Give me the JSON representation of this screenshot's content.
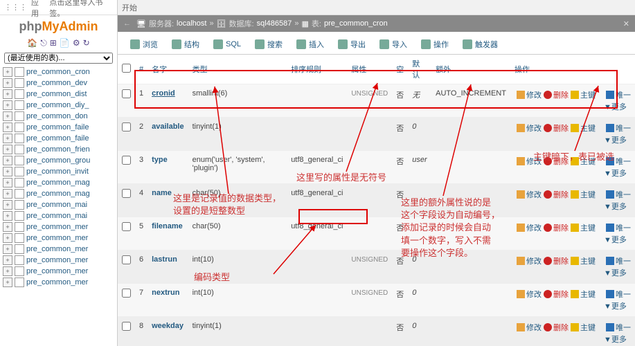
{
  "browser": {
    "apps": "应用",
    "hint": "点击这里导入书签。",
    "start": "开始"
  },
  "logo": {
    "p": "php",
    "m": "My",
    "a": "Admin"
  },
  "recent": {
    "placeholder": "(最近使用的表)..."
  },
  "tree_prefix": "pre_common_",
  "tree_items": [
    "cron",
    "dev",
    "dist",
    "diy_",
    "don",
    "faile",
    "faile",
    "frien",
    "grou",
    "invit",
    "mag",
    "mag",
    "mai",
    "mai",
    "mer",
    "mer",
    "mer",
    "mer",
    "mer",
    "mer"
  ],
  "bc": {
    "server_lbl": "服务器:",
    "server": "localhost",
    "db_lbl": "数据库:",
    "db": "sql486587",
    "tbl_lbl": "表:",
    "tbl": "pre_common_cron"
  },
  "tabs": [
    "浏览",
    "结构",
    "SQL",
    "搜索",
    "插入",
    "导出",
    "导入",
    "操作",
    "触发器"
  ],
  "th": {
    "num": "#",
    "name": "名字",
    "type": "类型",
    "coll": "排序规则",
    "attr": "属性",
    "null": "空",
    "def": "默认",
    "extra": "额外",
    "ops": "操作"
  },
  "op": {
    "edit": "修改",
    "del": "删除",
    "pk": "主键",
    "uq": "唯一",
    "more": "更多"
  },
  "null_no": "否",
  "rows": [
    {
      "n": 1,
      "name": "cronid",
      "u": true,
      "type": "smallint(6)",
      "coll": "",
      "attr": "UNSIGNED",
      "def": "无",
      "extra": "AUTO_INCREMENT"
    },
    {
      "n": 2,
      "name": "available",
      "u": false,
      "type": "tinyint(1)",
      "coll": "",
      "attr": "",
      "def": "0",
      "extra": ""
    },
    {
      "n": 3,
      "name": "type",
      "u": false,
      "type": "enum('user', 'system', 'plugin')",
      "coll": "utf8_general_ci",
      "attr": "",
      "def": "user",
      "extra": ""
    },
    {
      "n": 4,
      "name": "name",
      "u": false,
      "type": "char(50)",
      "coll": "utf8_general_ci",
      "attr": "",
      "def": "",
      "extra": ""
    },
    {
      "n": 5,
      "name": "filename",
      "u": false,
      "type": "char(50)",
      "coll": "utf8_general_ci",
      "attr": "",
      "def": "",
      "extra": ""
    },
    {
      "n": 6,
      "name": "lastrun",
      "u": false,
      "type": "int(10)",
      "coll": "",
      "attr": "UNSIGNED",
      "def": "0",
      "extra": ""
    },
    {
      "n": 7,
      "name": "nextrun",
      "u": false,
      "type": "int(10)",
      "coll": "",
      "attr": "UNSIGNED",
      "def": "0",
      "extra": ""
    },
    {
      "n": 8,
      "name": "weekday",
      "u": false,
      "type": "tinyint(1)",
      "coll": "",
      "attr": "",
      "def": "0",
      "extra": ""
    }
  ],
  "notes": {
    "a": "这里是记录值的数据类型，\n设置的是短整数型",
    "b": "这里写的属性是无符号",
    "c": "这里的额外属性说的是\n这个字段设为自动编号，\n添加记录的时候会自动\n填一个数字，写入不需\n要操作这个字段。",
    "d": "主键暗下，表已被选",
    "e": "编码类型"
  }
}
